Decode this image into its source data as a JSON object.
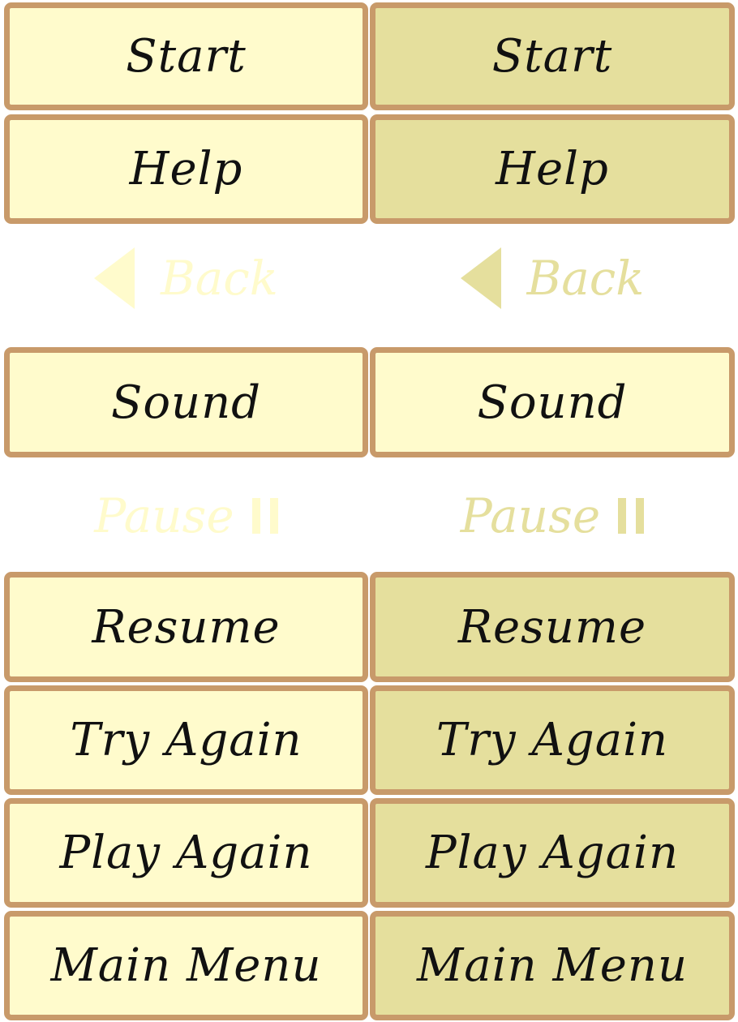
{
  "buttons": {
    "start": "Start",
    "help": "Help",
    "back": "Back",
    "sound": "Sound",
    "pause": "Pause",
    "resume": "Resume",
    "try_again": "Try Again",
    "play_again": "Play Again",
    "main_menu": "Main Menu"
  },
  "icons": {
    "back": "triangle-left-icon",
    "pause": "pause-icon"
  },
  "colors": {
    "border": "#c89a6a",
    "normal_fill": "#fffbcc",
    "hover_fill": "#e5df9d",
    "text": "#111111"
  }
}
